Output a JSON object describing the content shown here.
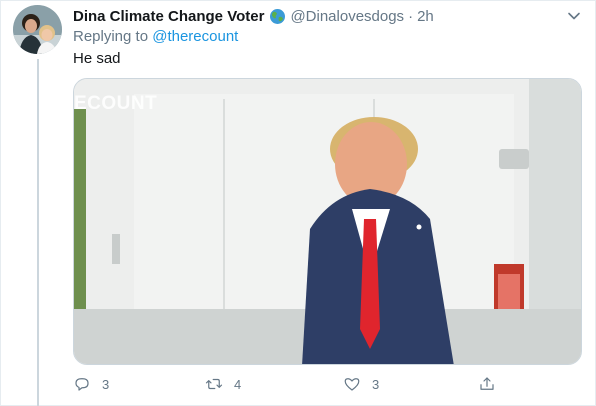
{
  "tweet": {
    "display_name": "Dina Climate Change Voter",
    "handle": "@Dinalovesdogs",
    "separator": "·",
    "time": "2h",
    "replying_prefix": "Replying to",
    "replying_to": "@therecount",
    "text": "He sad",
    "media": {
      "watermark": "ECOUNT"
    },
    "actions": {
      "reply_count": "3",
      "retweet_count": "4",
      "like_count": "3"
    }
  },
  "icons": {
    "globe": "globe-emoji-icon",
    "caret": "chevron-down-icon",
    "reply": "reply-bubble-icon",
    "retweet": "retweet-icon",
    "like": "heart-icon",
    "share": "share-icon"
  },
  "colors": {
    "link": "#1b95e0",
    "secondary_text": "#657786",
    "primary_text": "#14171a",
    "border": "#e6ecf0"
  }
}
